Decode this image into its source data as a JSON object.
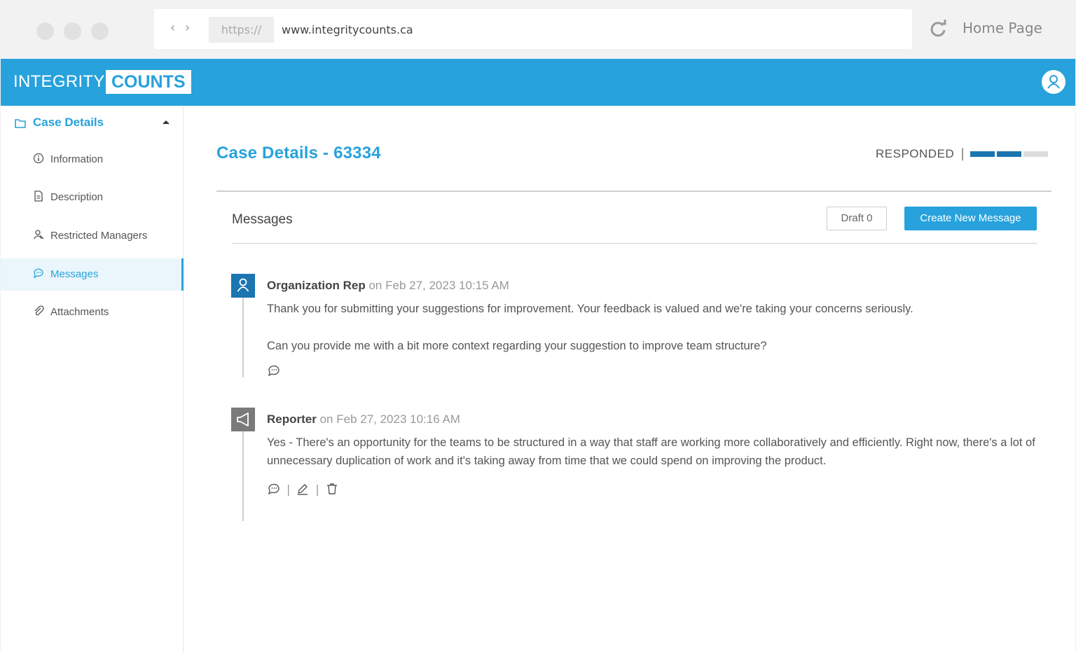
{
  "browser": {
    "protocol": "https://",
    "url": "www.integritycounts.ca",
    "home_label": "Home Page"
  },
  "brand": {
    "part1": "INTEGRITY",
    "part2": "COUNTS",
    "color": "#27a2dc"
  },
  "sidebar": {
    "section": "Case Details",
    "items": [
      {
        "label": "Information",
        "icon": "info-icon"
      },
      {
        "label": "Description",
        "icon": "document-icon"
      },
      {
        "label": "Restricted Managers",
        "icon": "restricted-user-icon"
      },
      {
        "label": "Messages",
        "icon": "chat-icon",
        "active": true
      },
      {
        "label": "Attachments",
        "icon": "paperclip-icon"
      }
    ]
  },
  "case": {
    "title": "Case Details - 63334",
    "status": "RESPONDED",
    "status_separator": "|",
    "progress": {
      "completed": 2,
      "total": 3
    }
  },
  "messages": {
    "title": "Messages",
    "draft_label": "Draft 0",
    "create_label": "Create New Message",
    "items": [
      {
        "author": "Organization Rep",
        "time": "on Feb 27, 2023 10:15 AM",
        "paragraphs": [
          "Thank you for submitting your suggestions for improvement. Your feedback is valued and we're taking your concerns seriously.",
          "Can you provide me with a bit more context regarding your suggestion to improve team structure?"
        ]
      },
      {
        "author": "Reporter",
        "time": "on Feb 27, 2023 10:16 AM",
        "paragraphs": [
          "Yes - There's an opportunity for the teams to be structured in a way that staff are working more collaboratively and efficiently. Right now, there's a lot of unnecessary duplication of work and it's taking away from time that we could spend on improving the product."
        ],
        "action_separator": "|"
      }
    ]
  }
}
